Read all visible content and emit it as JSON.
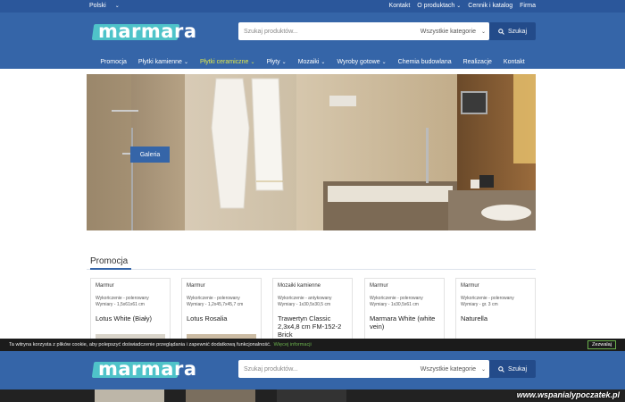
{
  "topbar": {
    "language": "Polski",
    "links": [
      "Kontakt",
      "O produktach",
      "Cennik i katalog",
      "Firma"
    ]
  },
  "header": {
    "logo_text": "marmara",
    "search_placeholder": "Szukaj produktów...",
    "category_select": "Wszystkie kategorie",
    "search_button": "Szukaj"
  },
  "nav": {
    "items": [
      {
        "label": "Promocja",
        "has_dropdown": false
      },
      {
        "label": "Płytki kamienne",
        "has_dropdown": true
      },
      {
        "label": "Płytki ceramiczne",
        "has_dropdown": true,
        "active": true
      },
      {
        "label": "Płyty",
        "has_dropdown": true
      },
      {
        "label": "Mozaiki",
        "has_dropdown": true
      },
      {
        "label": "Wyroby gotowe",
        "has_dropdown": true
      },
      {
        "label": "Chemia budowlana",
        "has_dropdown": false
      },
      {
        "label": "Realizacje",
        "has_dropdown": false
      },
      {
        "label": "Kontakt",
        "has_dropdown": false
      }
    ]
  },
  "hero": {
    "button": "Galeria"
  },
  "promo": {
    "title": "Promocja",
    "cards": [
      {
        "category": "Marmur",
        "line1": "Wykończenie - polerowany",
        "line2": "Wymiary - 1,5x61x61 cm",
        "name": "Lotus White (Biały)"
      },
      {
        "category": "Marmur",
        "line1": "Wykończenie - polerowany",
        "line2": "Wymiary - 1,2x45,7x45,7 cm",
        "name": "Lotus Rosalia"
      },
      {
        "category": "Mozaiki kamienne",
        "line1": "Wykończenie - antykowany",
        "line2": "Wymiary - 1x30,5x30,5 cm",
        "name": "Trawertyn Classic 2,3x4,8 cm FM-152-2 Brick"
      },
      {
        "category": "Marmur",
        "line1": "Wykończenie - polerowany",
        "line2": "Wymiary - 1x30,5x61 cm",
        "name": "Marmara White (white vein)"
      },
      {
        "category": "Marmur",
        "line1": "Wykończenie - polerowany",
        "line2": "Wymiary - gr. 3 cm",
        "name": "Naturella"
      }
    ]
  },
  "cookie": {
    "text": "Ta witryna korzysta z plików cookie, aby polepszyć doświadczenie przeglądania i zapewnić dodatkową funkcjonalność.",
    "more": "Więcej informacji",
    "accept": "Zezwalaj"
  },
  "watermark": "www.wspanialypoczatek.pl",
  "colors": {
    "header_blue": "#3565a8",
    "topbar_blue": "#2b579b",
    "active_nav": "#e0e84a",
    "logo_accent": "#4fc3c9"
  }
}
